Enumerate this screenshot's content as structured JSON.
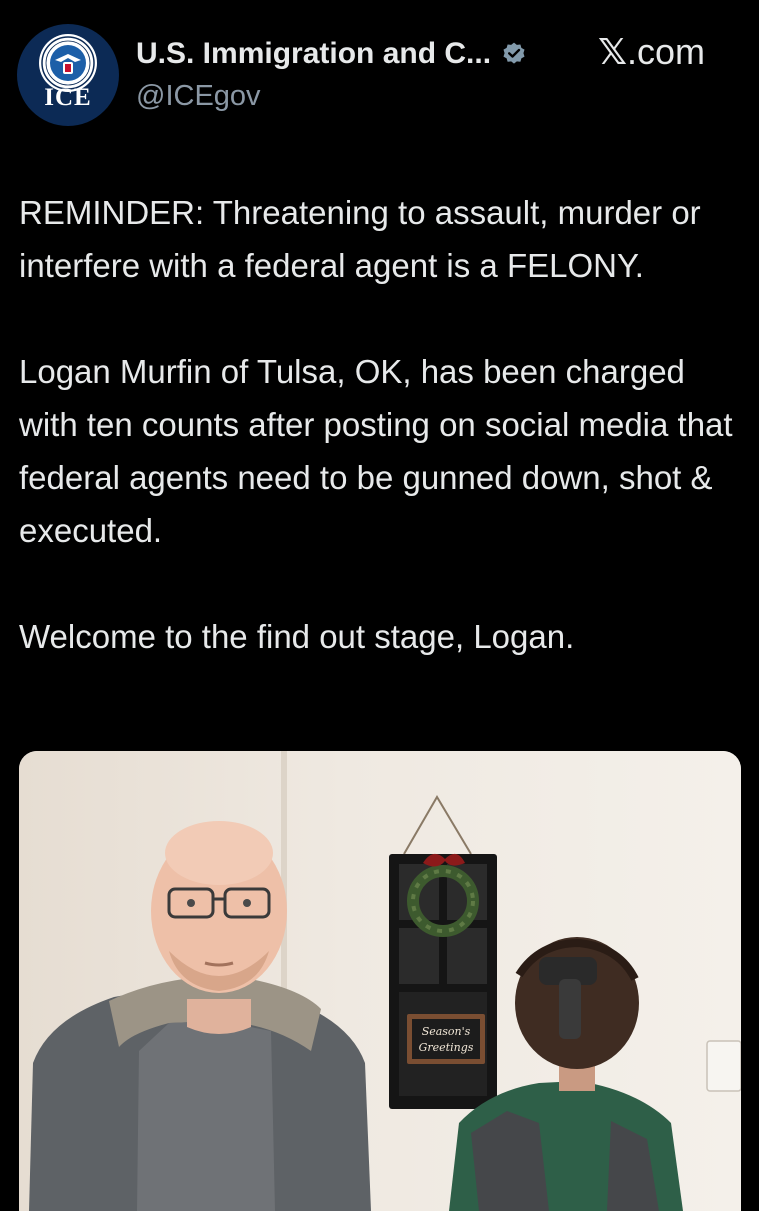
{
  "account": {
    "avatar_text": "ICE",
    "display_name": "U.S. Immigration and C...",
    "handle": "@ICEgov",
    "verified_icon": "verified-badge-icon"
  },
  "site": {
    "logo_glyph": "𝕏",
    "name": ".com"
  },
  "tweet": {
    "paragraphs": [
      "REMINDER: Threatening to assault, murder or interfere with a federal agent is a FELONY.",
      "Logan Murfin of Tulsa, OK, has been charged with ten counts after posting on social media that federal agents need to be gunned down, shot & executed.",
      "Welcome to the find out stage, Logan."
    ]
  },
  "media": {
    "sign_line1": "Season's",
    "sign_line2": "Greetings"
  },
  "colors": {
    "background": "#000000",
    "text": "#e7e9ea",
    "secondary_text": "#8b98a5",
    "avatar_bg": "#0c2a55"
  }
}
